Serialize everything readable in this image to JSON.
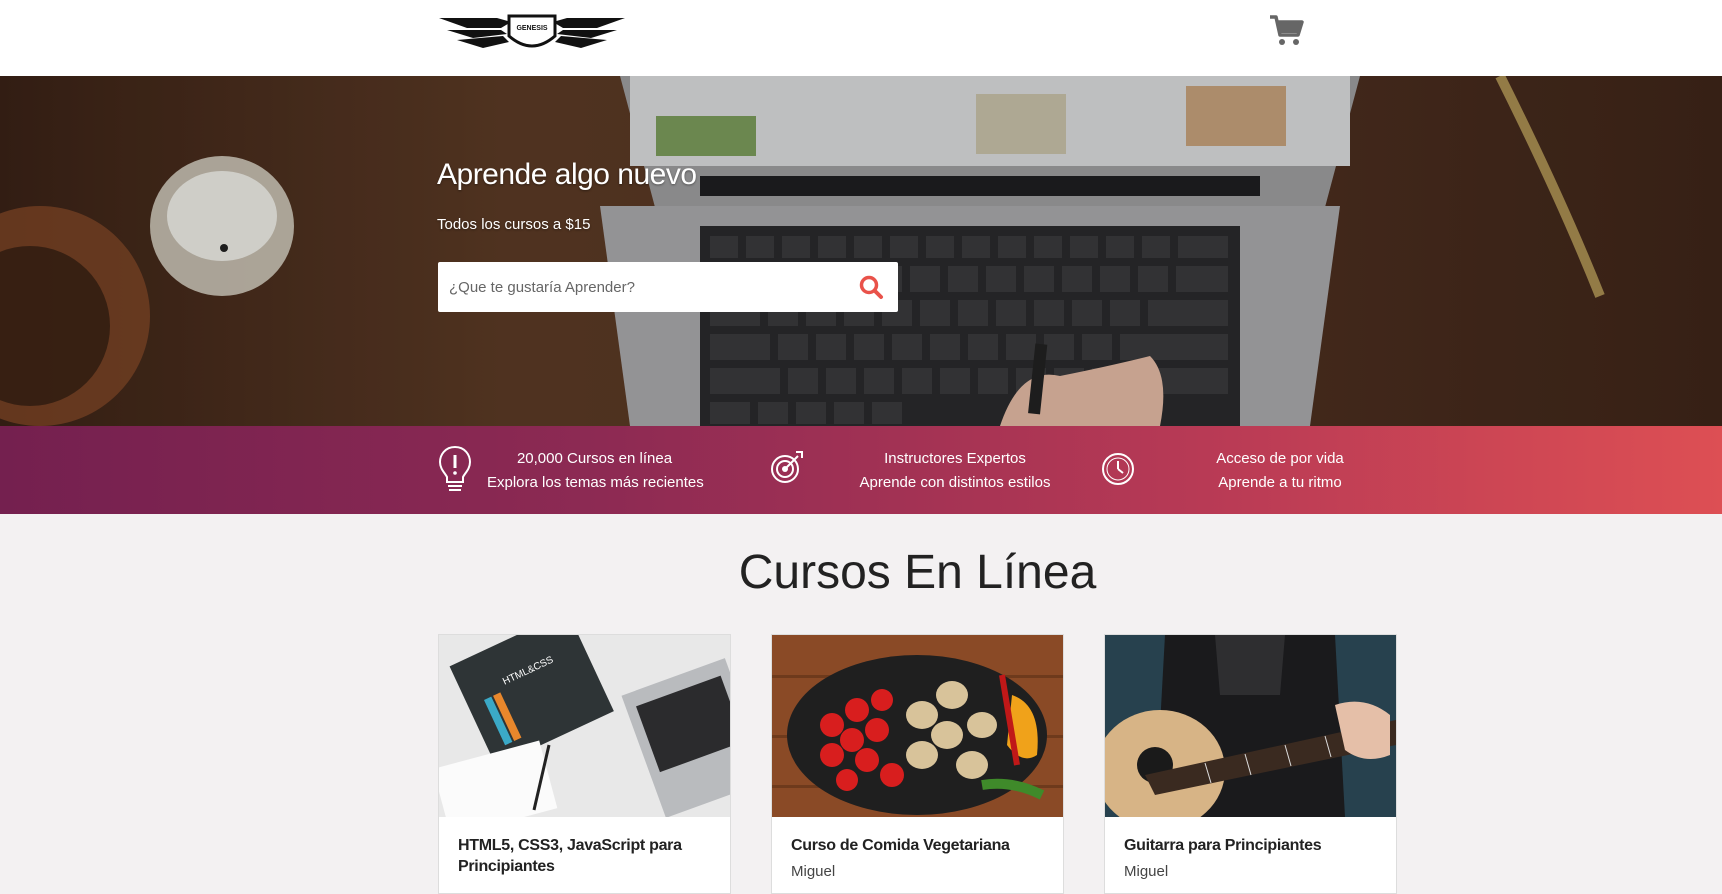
{
  "header": {
    "logo_text": "GENESIS",
    "cart_icon": "shopping-cart-icon"
  },
  "hero": {
    "title": "Aprende algo nuevo",
    "subtitle": "Todos los cursos a $15",
    "search_placeholder": "¿Que te gustaría Aprender?",
    "search_icon": "search-icon",
    "accent_color": "#e9524a"
  },
  "features": [
    {
      "icon": "lightbulb-icon",
      "line1": "20,000 Cursos en línea",
      "line2": "Explora los temas más recientes"
    },
    {
      "icon": "target-icon",
      "line1": "Instructores Expertos",
      "line2": "Aprende con distintos estilos"
    },
    {
      "icon": "clock-icon",
      "line1": "Acceso de por vida",
      "line2": "Aprende a tu ritmo"
    }
  ],
  "courses": {
    "title": "Cursos En Línea",
    "items": [
      {
        "title": "HTML5, CSS3, JavaScript para Principiantes",
        "author": "",
        "image": "html-css-book-laptop"
      },
      {
        "title": "Curso de Comida Vegetariana",
        "author": "Miguel",
        "image": "vegetables-pan"
      },
      {
        "title": "Guitarra para Principiantes",
        "author": "Miguel",
        "image": "acoustic-guitar"
      }
    ]
  },
  "colors": {
    "band_start": "#74204f",
    "band_end": "#dd4f54",
    "page_bg": "#f3f1f2"
  }
}
